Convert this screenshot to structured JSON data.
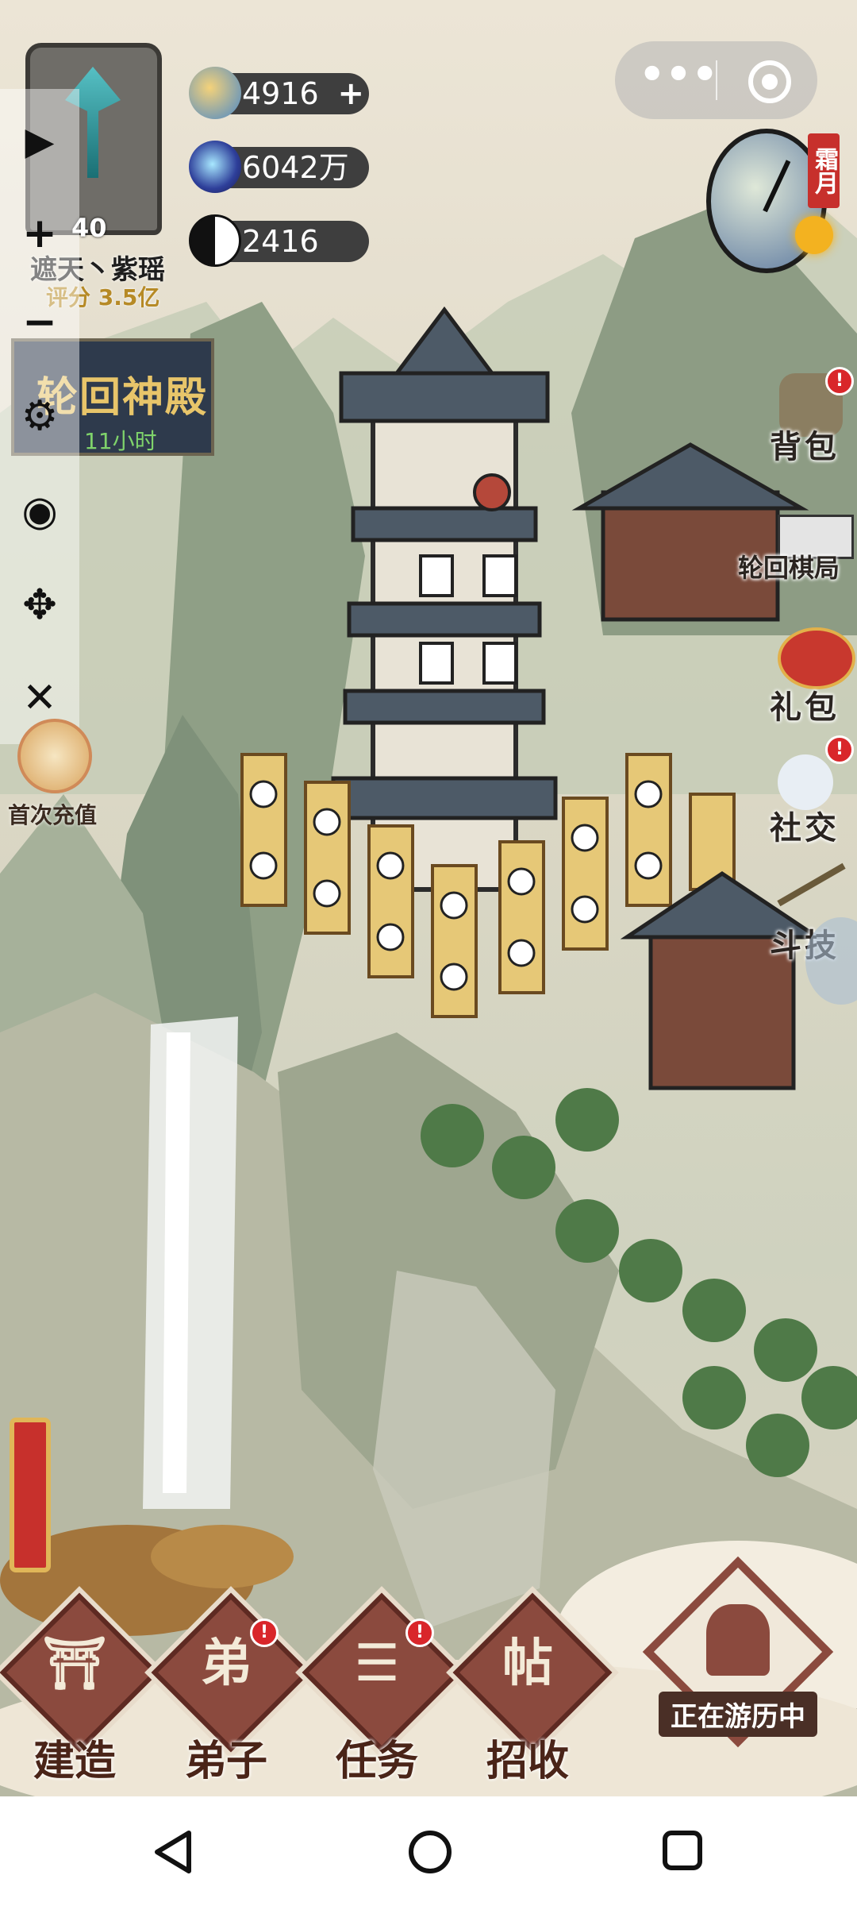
{
  "player": {
    "level": "40",
    "name": "遮天丶紫瑶",
    "score": "评分 3.5亿"
  },
  "resources": [
    {
      "icon": "spirit-cloud-icon",
      "value": "4916",
      "has_plus": true
    },
    {
      "icon": "blue-gem-icon",
      "value": "6042万",
      "has_plus": false
    },
    {
      "icon": "yin-yang-icon",
      "value": "2416",
      "has_plus": false
    }
  ],
  "event_banner": {
    "title": "轮回神殿",
    "timer": "11小时"
  },
  "toolbar": {
    "zoom_in": "+",
    "zoom_out": "−",
    "settings_icon": "gear-icon",
    "view_icon": "eye-icon",
    "move_icon": "move-arrows-icon",
    "close_icon": "close-icon"
  },
  "first_recharge": {
    "label": "首次充值"
  },
  "season": {
    "label": "霜月"
  },
  "right_menu": [
    {
      "label": "背包",
      "badge": "!"
    },
    {
      "label": "轮回棋局",
      "badge": ""
    },
    {
      "label": "礼包",
      "badge": ""
    },
    {
      "label": "社交",
      "badge": "!"
    },
    {
      "label": "斗技",
      "badge": ""
    }
  ],
  "bottom_nav": [
    {
      "label": "建造",
      "icon": "pavilion-icon",
      "badge": ""
    },
    {
      "label": "弟子",
      "icon": "disciple-icon",
      "badge": "!"
    },
    {
      "label": "任务",
      "icon": "scroll-task-icon",
      "badge": "!"
    },
    {
      "label": "招收",
      "icon": "recruit-card-icon",
      "badge": ""
    }
  ],
  "travel": {
    "label": "正在游历中"
  },
  "colors": {
    "accent_red": "#d9262a",
    "nav_diamond": "#8b4a3e",
    "resource_bar": "#3e3e3e"
  }
}
